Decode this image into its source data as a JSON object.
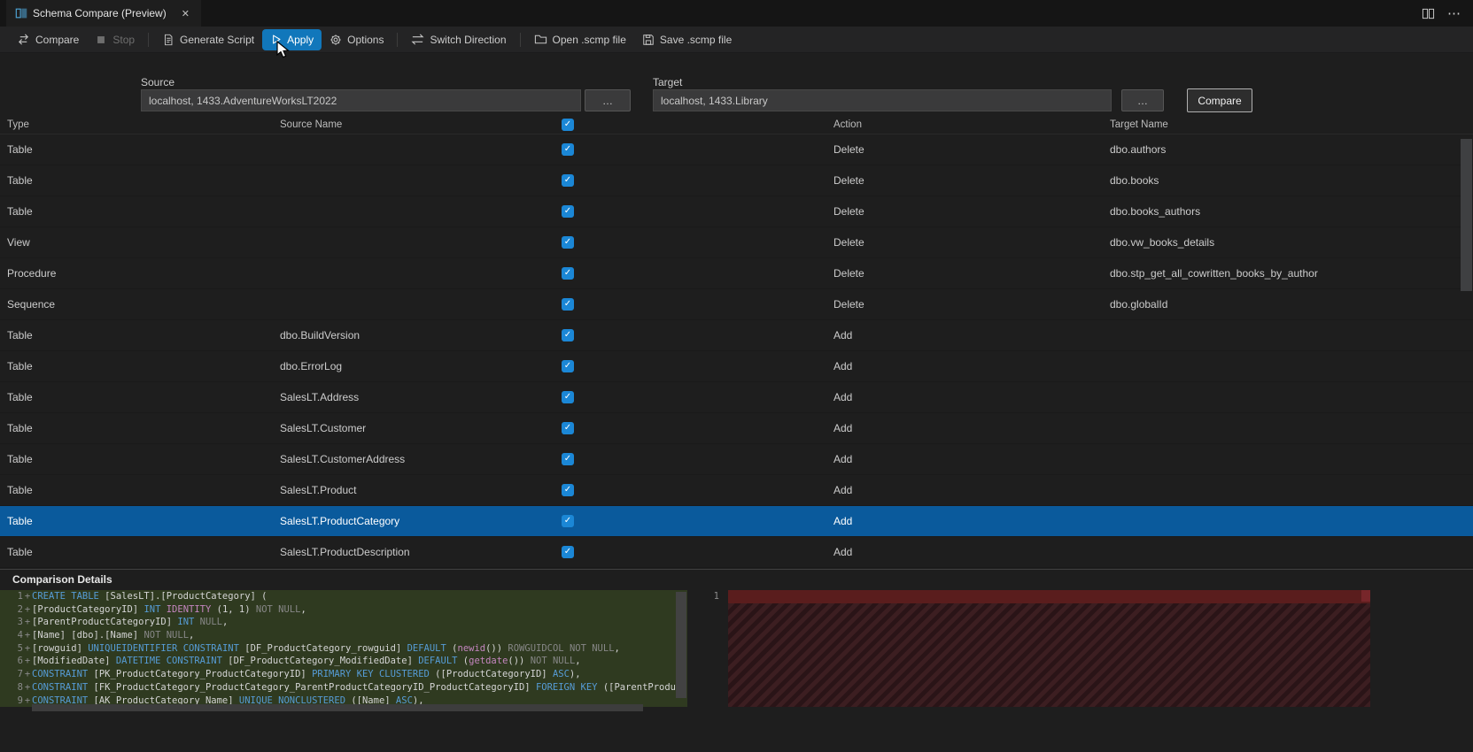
{
  "tab": {
    "title": "Schema Compare (Preview)",
    "close_glyph": "✕"
  },
  "window_actions": {
    "more_glyph": "⋯"
  },
  "toolbar": {
    "compare": "Compare",
    "stop": "Stop",
    "generate_script": "Generate Script",
    "apply": "Apply",
    "options": "Options",
    "switch_direction": "Switch Direction",
    "open_scmp": "Open .scmp file",
    "save_scmp": "Save .scmp file"
  },
  "connections": {
    "source_label": "Source",
    "source_value": "localhost, 1433.AdventureWorksLT2022",
    "target_label": "Target",
    "target_value": "localhost, 1433.Library",
    "browse_glyph": "…",
    "compare_button": "Compare"
  },
  "grid": {
    "headers": {
      "type": "Type",
      "source_name": "Source Name",
      "action": "Action",
      "target_name": "Target Name"
    },
    "header_checkbox_checked": true,
    "check_glyph": "✓",
    "rows": [
      {
        "type": "Table",
        "source": "",
        "checked": true,
        "action": "Delete",
        "target": "dbo.authors",
        "selected": false
      },
      {
        "type": "Table",
        "source": "",
        "checked": true,
        "action": "Delete",
        "target": "dbo.books",
        "selected": false
      },
      {
        "type": "Table",
        "source": "",
        "checked": true,
        "action": "Delete",
        "target": "dbo.books_authors",
        "selected": false
      },
      {
        "type": "View",
        "source": "",
        "checked": true,
        "action": "Delete",
        "target": "dbo.vw_books_details",
        "selected": false
      },
      {
        "type": "Procedure",
        "source": "",
        "checked": true,
        "action": "Delete",
        "target": "dbo.stp_get_all_cowritten_books_by_author",
        "selected": false
      },
      {
        "type": "Sequence",
        "source": "",
        "checked": true,
        "action": "Delete",
        "target": "dbo.globalId",
        "selected": false
      },
      {
        "type": "Table",
        "source": "dbo.BuildVersion",
        "checked": true,
        "action": "Add",
        "target": "",
        "selected": false
      },
      {
        "type": "Table",
        "source": "dbo.ErrorLog",
        "checked": true,
        "action": "Add",
        "target": "",
        "selected": false
      },
      {
        "type": "Table",
        "source": "SalesLT.Address",
        "checked": true,
        "action": "Add",
        "target": "",
        "selected": false
      },
      {
        "type": "Table",
        "source": "SalesLT.Customer",
        "checked": true,
        "action": "Add",
        "target": "",
        "selected": false
      },
      {
        "type": "Table",
        "source": "SalesLT.CustomerAddress",
        "checked": true,
        "action": "Add",
        "target": "",
        "selected": false
      },
      {
        "type": "Table",
        "source": "SalesLT.Product",
        "checked": true,
        "action": "Add",
        "target": "",
        "selected": false
      },
      {
        "type": "Table",
        "source": "SalesLT.ProductCategory",
        "checked": true,
        "action": "Add",
        "target": "",
        "selected": true
      },
      {
        "type": "Table",
        "source": "SalesLT.ProductDescription",
        "checked": true,
        "action": "Add",
        "target": "",
        "selected": false
      }
    ]
  },
  "details": {
    "title": "Comparison Details",
    "right_gutter_line": "1",
    "left_code": [
      {
        "num": "1",
        "sign": "+",
        "segments": [
          [
            "k",
            "CREATE TABLE"
          ],
          [
            "d",
            " [SalesLT].[ProductCategory] ("
          ]
        ]
      },
      {
        "num": "2",
        "sign": "+",
        "segments": [
          [
            "d",
            "[ProductCategoryID] "
          ],
          [
            "k",
            "INT"
          ],
          [
            "d",
            " "
          ],
          [
            "f",
            "IDENTITY"
          ],
          [
            "d",
            " (1, 1) "
          ],
          [
            "g",
            "NOT NULL"
          ],
          [
            "d",
            ","
          ]
        ]
      },
      {
        "num": "3",
        "sign": "+",
        "segments": [
          [
            "d",
            "[ParentProductCategoryID] "
          ],
          [
            "k",
            "INT"
          ],
          [
            "d",
            " "
          ],
          [
            "g",
            "NULL"
          ],
          [
            "d",
            ","
          ]
        ]
      },
      {
        "num": "4",
        "sign": "+",
        "segments": [
          [
            "d",
            "[Name] [dbo].[Name] "
          ],
          [
            "g",
            "NOT NULL"
          ],
          [
            "d",
            ","
          ]
        ]
      },
      {
        "num": "5",
        "sign": "+",
        "segments": [
          [
            "d",
            "[rowguid] "
          ],
          [
            "k",
            "UNIQUEIDENTIFIER"
          ],
          [
            "d",
            " "
          ],
          [
            "k",
            "CONSTRAINT"
          ],
          [
            "d",
            " [DF_ProductCategory_rowguid] "
          ],
          [
            "k",
            "DEFAULT"
          ],
          [
            "d",
            " ("
          ],
          [
            "f",
            "newid"
          ],
          [
            "d",
            "()) "
          ],
          [
            "g",
            "ROWGUIDCOL NOT NULL"
          ],
          [
            "d",
            ","
          ]
        ]
      },
      {
        "num": "6",
        "sign": "+",
        "segments": [
          [
            "d",
            "[ModifiedDate] "
          ],
          [
            "k",
            "DATETIME"
          ],
          [
            "d",
            " "
          ],
          [
            "k",
            "CONSTRAINT"
          ],
          [
            "d",
            " [DF_ProductCategory_ModifiedDate] "
          ],
          [
            "k",
            "DEFAULT"
          ],
          [
            "d",
            " ("
          ],
          [
            "f",
            "getdate"
          ],
          [
            "d",
            "()) "
          ],
          [
            "g",
            "NOT NULL"
          ],
          [
            "d",
            ","
          ]
        ]
      },
      {
        "num": "7",
        "sign": "+",
        "segments": [
          [
            "k",
            "CONSTRAINT"
          ],
          [
            "d",
            " [PK_ProductCategory_ProductCategoryID] "
          ],
          [
            "k",
            "PRIMARY KEY CLUSTERED"
          ],
          [
            "d",
            " ([ProductCategoryID] "
          ],
          [
            "k",
            "ASC"
          ],
          [
            "d",
            "),"
          ]
        ]
      },
      {
        "num": "8",
        "sign": "+",
        "segments": [
          [
            "k",
            "CONSTRAINT"
          ],
          [
            "d",
            " [FK_ProductCategory_ProductCategory_ParentProductCategoryID_ProductCategoryID] "
          ],
          [
            "k",
            "FOREIGN KEY"
          ],
          [
            "d",
            " ([ParentProductCatego"
          ]
        ]
      },
      {
        "num": "9",
        "sign": "+",
        "segments": [
          [
            "k",
            "CONSTRAINT"
          ],
          [
            "d",
            " [AK_ProductCategory_Name] "
          ],
          [
            "k",
            "UNIQUE NONCLUSTERED"
          ],
          [
            "d",
            " ([Name] "
          ],
          [
            "k",
            "ASC"
          ],
          [
            "d",
            "),"
          ]
        ]
      }
    ]
  },
  "colors": {
    "selection_blue": "#0a5a9c",
    "checkbox_blue": "#1b87d6",
    "apply_pill_blue": "#1177bb",
    "diff_added_bg": "#2f3a20",
    "diff_removed_bg": "#3c1e21",
    "keyword_blue": "#569cd6",
    "function_pink": "#c586c0"
  }
}
